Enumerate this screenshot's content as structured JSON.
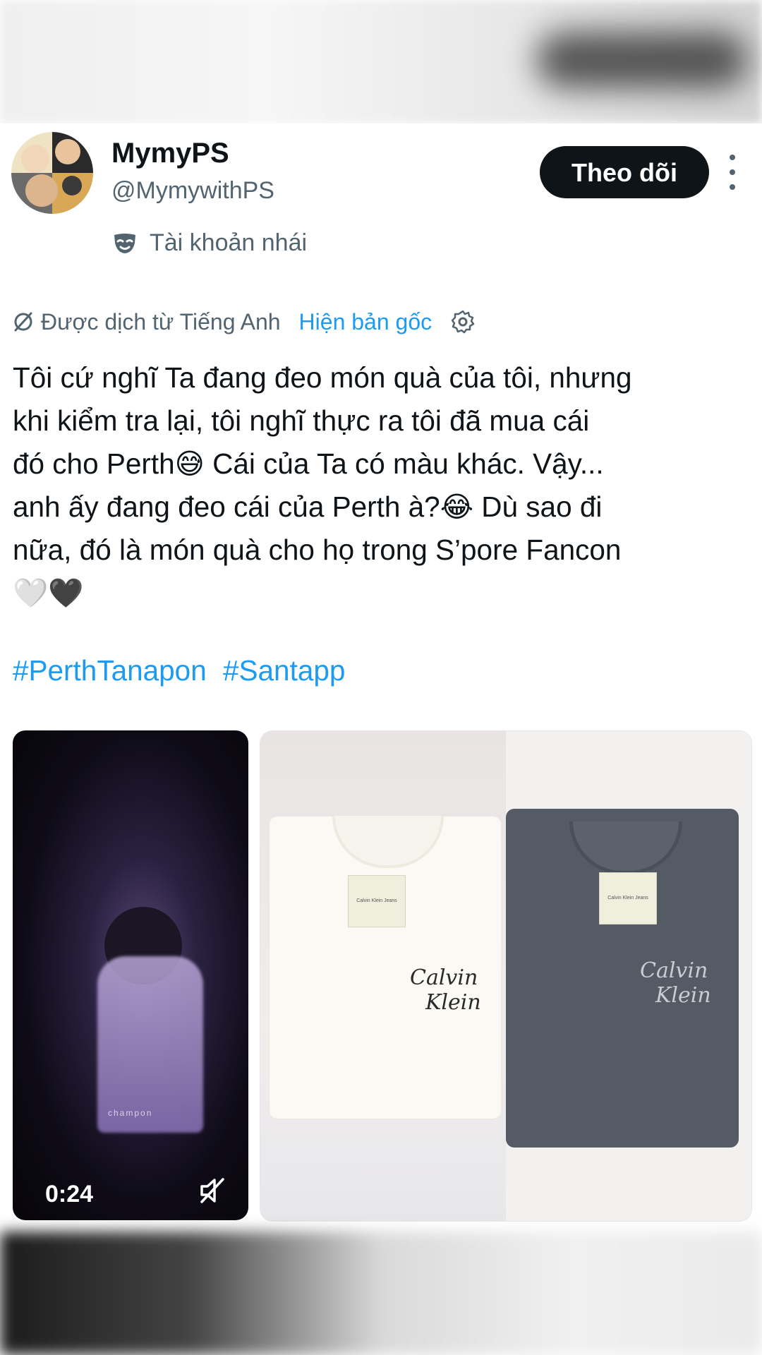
{
  "tweet": {
    "author_name": "MymyPS",
    "author_handle": "@MymywithPS",
    "follow_label": "Theo dõi",
    "account_label": "Tài khoản nhái",
    "translation_note": "Được dịch từ Tiếng Anh",
    "show_original_label": "Hiện bản gốc",
    "text": "Tôi cứ nghĩ Ta đang đeo món quà của tôi, nhưng\nkhi kiểm tra lại, tôi nghĩ thực ra tôi đã mua cái\nđó cho Perth😅 Cái của Ta có màu khác. Vậy...\nanh ấy đang đeo cái của Perth à?😂 Dù sao đi\nnữa, đó là món quà cho họ trong S’pore Fancon\n🤍🖤",
    "hashtags": [
      "#PerthTanapon",
      "#Santapp"
    ]
  },
  "media": {
    "video_duration": "0:24",
    "video_watermark": "champon",
    "shirt_tag_text": "Calvin Klein Jeans",
    "shirt_logo_line1": "Calvin",
    "shirt_logo_line2": "Klein"
  },
  "colors": {
    "link": "#1d9bf0",
    "secondary_text": "#536471",
    "primary_text": "#0f1419",
    "follow_button_bg": "#0f1419"
  },
  "icons": [
    "more-options-icon",
    "parody-mask-icon",
    "translate-icon",
    "settings-gear-icon",
    "mute-icon"
  ]
}
